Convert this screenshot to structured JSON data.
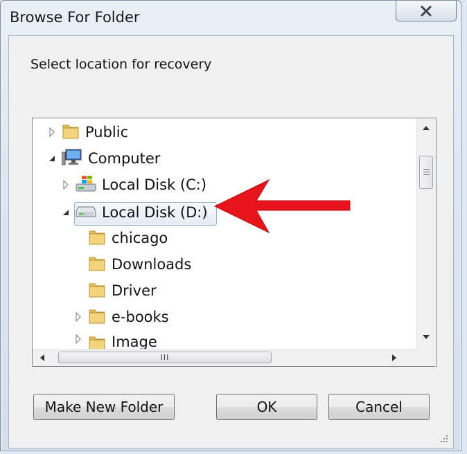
{
  "window": {
    "title": "Browse For Folder",
    "close_label": "Close"
  },
  "dialog": {
    "prompt": "Select location for recovery"
  },
  "tree": {
    "items": [
      {
        "label": "Public",
        "icon": "folder-icon",
        "expander": "collapsed"
      },
      {
        "label": "Computer",
        "icon": "computer-icon",
        "expander": "expanded"
      },
      {
        "label": "Local Disk (C:)",
        "icon": "windows-drive-icon",
        "expander": "collapsed"
      },
      {
        "label": "Local Disk (D:)",
        "icon": "drive-icon",
        "expander": "expanded",
        "selected": true
      },
      {
        "label": "chicago",
        "icon": "folder-icon",
        "expander": "none"
      },
      {
        "label": "Downloads",
        "icon": "folder-icon",
        "expander": "none"
      },
      {
        "label": "Driver",
        "icon": "folder-icon",
        "expander": "none"
      },
      {
        "label": "e-books",
        "icon": "folder-icon",
        "expander": "collapsed"
      },
      {
        "label": "Image",
        "icon": "folder-icon",
        "expander": "collapsed"
      }
    ]
  },
  "scrollbars": {
    "horizontal_grip": "III"
  },
  "buttons": {
    "make_new_folder": "Make New Folder",
    "ok": "OK",
    "cancel": "Cancel"
  },
  "colors": {
    "annotation_arrow": "#e8141b",
    "folder": "#e9c46a",
    "selection_border": "#99b4d1"
  }
}
